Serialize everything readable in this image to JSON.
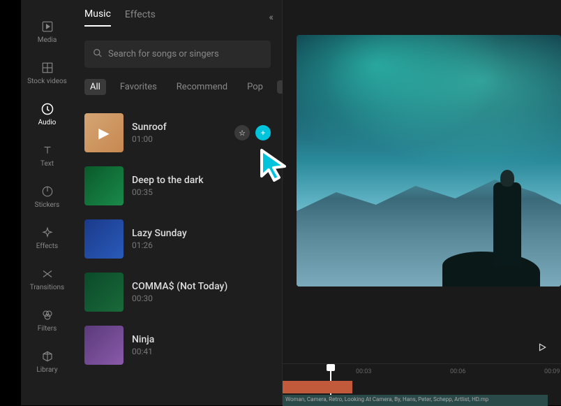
{
  "sidebar": {
    "items": [
      {
        "label": "Media",
        "icon": "play-box"
      },
      {
        "label": "Stock videos",
        "icon": "grid"
      },
      {
        "label": "Audio",
        "icon": "audio",
        "active": true
      },
      {
        "label": "Text",
        "icon": "text"
      },
      {
        "label": "Stickers",
        "icon": "clock"
      },
      {
        "label": "Effects",
        "icon": "sparkle"
      },
      {
        "label": "Transitions",
        "icon": "transitions"
      },
      {
        "label": "Filters",
        "icon": "filters"
      },
      {
        "label": "Library",
        "icon": "cube"
      }
    ]
  },
  "panel": {
    "tabs": [
      {
        "label": "Music",
        "active": true
      },
      {
        "label": "Effects"
      }
    ],
    "search_placeholder": "Search for songs or singers",
    "filters": [
      {
        "label": "All",
        "active": true
      },
      {
        "label": "Favorites"
      },
      {
        "label": "Recommend"
      },
      {
        "label": "Pop"
      }
    ],
    "tracks": [
      {
        "title": "Sunroof",
        "duration": "01:00",
        "playing": true,
        "actions": true
      },
      {
        "title": "Deep to the dark",
        "duration": "00:35"
      },
      {
        "title": "Lazy Sunday",
        "duration": "01:26"
      },
      {
        "title": "COMMA$ (Not Today)",
        "duration": "00:30"
      },
      {
        "title": "Ninja",
        "duration": "00:41"
      }
    ]
  },
  "timeline": {
    "marks": [
      "00:03",
      "00:06",
      "00:09"
    ],
    "clip_label": "Woman, Camera, Retro, Looking At Camera, By, Hans, Peter, Schepp, Artlist, HD.mp"
  }
}
